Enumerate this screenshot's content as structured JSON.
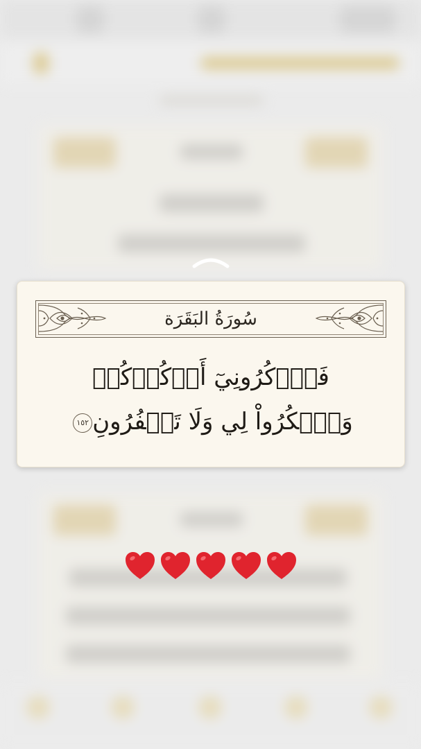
{
  "verse_card": {
    "surah_title": "سُورَةُ البَقَرَة",
    "verse_line_1": "فَٱذۡكُرُونِيٓ أَذۡكُرۡكُمۡ",
    "verse_line_2": "وَٱشۡكُرُواْ لِي وَلَا تَكۡفُرُونِ",
    "ayah_number": "١٥٢"
  },
  "hearts": {
    "count": 5,
    "icon": "red-heart-icon",
    "color": "#e0242e"
  },
  "colors": {
    "card_background": "#fbf7ee",
    "frame_border": "#6a5f50",
    "page_background": "#ebebeb"
  }
}
